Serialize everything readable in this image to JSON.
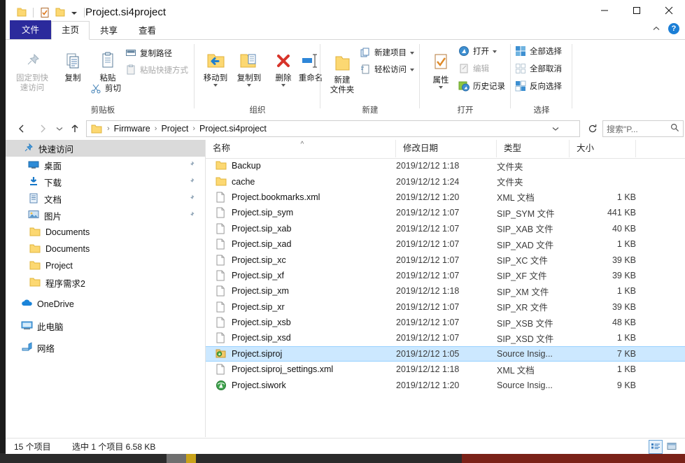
{
  "window": {
    "title": "Project.si4project",
    "quick_access": [
      "folder-icon",
      "properties-icon",
      "new-folder-icon",
      "dropdown-caret-icon"
    ],
    "controls": {
      "minimize": "minimize-icon",
      "maximize": "maximize-icon",
      "close": "close-icon"
    }
  },
  "ribbon": {
    "tabs": [
      {
        "label": "文件",
        "kind": "file"
      },
      {
        "label": "主页",
        "kind": "active"
      },
      {
        "label": "共享",
        "kind": "normal"
      },
      {
        "label": "查看",
        "kind": "normal"
      }
    ],
    "collapse_icon": "chevron-up-icon",
    "help_label": "?",
    "groups": [
      {
        "name": "剪贴板",
        "big_buttons": [
          {
            "label": "固定到快\n速访问",
            "icon": "pin-icon",
            "disabled": true
          },
          {
            "label": "复制",
            "icon": "copy-icon",
            "disabled": false
          },
          {
            "label": "粘贴",
            "icon": "paste-icon",
            "disabled": false
          }
        ],
        "small_buttons": [
          {
            "label": "复制路径",
            "icon": "copy-path-icon",
            "disabled": false
          },
          {
            "label": "粘贴快捷方式",
            "icon": "paste-shortcut-icon",
            "disabled": true
          },
          {
            "label": "剪切",
            "icon": "scissors-icon",
            "disabled": false
          }
        ]
      },
      {
        "name": "组织",
        "big_buttons": [
          {
            "label": "移动到",
            "icon": "move-to-icon",
            "caret": true
          },
          {
            "label": "复制到",
            "icon": "copy-to-icon",
            "caret": true
          },
          {
            "label": "删除",
            "icon": "delete-icon",
            "caret": true
          },
          {
            "label": "重命名",
            "icon": "rename-icon",
            "caret": false
          }
        ]
      },
      {
        "name": "新建",
        "big_buttons": [
          {
            "label": "新建\n文件夹",
            "icon": "new-folder-icon"
          }
        ],
        "small_buttons": [
          {
            "label": "新建项目",
            "icon": "new-item-icon",
            "caret": true
          },
          {
            "label": "轻松访问",
            "icon": "easy-access-icon",
            "caret": true
          }
        ]
      },
      {
        "name": "打开",
        "big_buttons": [
          {
            "label": "属性",
            "icon": "properties-icon",
            "caret": true
          }
        ],
        "small_buttons": [
          {
            "label": "打开",
            "icon": "open-icon",
            "caret": true
          },
          {
            "label": "编辑",
            "icon": "edit-icon",
            "disabled": true
          },
          {
            "label": "历史记录",
            "icon": "history-icon"
          }
        ]
      },
      {
        "name": "选择",
        "small_buttons": [
          {
            "label": "全部选择",
            "icon": "select-all-icon"
          },
          {
            "label": "全部取消",
            "icon": "select-none-icon"
          },
          {
            "label": "反向选择",
            "icon": "invert-selection-icon"
          }
        ]
      }
    ]
  },
  "address": {
    "back_icon": "arrow-left-icon",
    "forward_icon": "arrow-right-icon",
    "recent_icon": "chevron-down-icon",
    "up_icon": "arrow-up-icon",
    "crumbs": [
      "Firmware",
      "Project",
      "Project.si4project"
    ],
    "dropdown_icon": "chevron-down-icon",
    "refresh_icon": "refresh-icon"
  },
  "search": {
    "placeholder": "搜索\"P...",
    "icon": "search-icon"
  },
  "sidebar": {
    "items": [
      {
        "label": "快速访问",
        "icon": "pin-star-icon",
        "selected": true,
        "indent": 0,
        "pinned": false
      },
      {
        "label": "桌面",
        "icon": "desktop-icon",
        "indent": 1,
        "pinned": true
      },
      {
        "label": "下载",
        "icon": "download-icon",
        "indent": 1,
        "pinned": true
      },
      {
        "label": "文档",
        "icon": "documents-icon",
        "indent": 1,
        "pinned": true
      },
      {
        "label": "图片",
        "icon": "pictures-icon",
        "indent": 1,
        "pinned": true
      },
      {
        "label": "Documents",
        "icon": "folder-icon",
        "indent": 1,
        "pinned": false
      },
      {
        "label": "Documents",
        "icon": "folder-icon",
        "indent": 1,
        "pinned": false
      },
      {
        "label": "Project",
        "icon": "folder-icon",
        "indent": 1,
        "pinned": false
      },
      {
        "label": "程序需求2",
        "icon": "folder-icon",
        "indent": 1,
        "pinned": false
      },
      {
        "label": "OneDrive",
        "icon": "onedrive-cloud-icon",
        "indent": 0,
        "pinned": false,
        "gap_before": true
      },
      {
        "label": "此电脑",
        "icon": "this-pc-icon",
        "indent": 0,
        "pinned": false,
        "gap_before": true
      },
      {
        "label": "网络",
        "icon": "network-icon",
        "indent": 0,
        "pinned": false,
        "gap_before": true
      }
    ]
  },
  "file_list": {
    "columns": [
      {
        "label": "名称",
        "sorted": true,
        "sort_mark": "^"
      },
      {
        "label": "修改日期",
        "sorted": false
      },
      {
        "label": "类型",
        "sorted": false
      },
      {
        "label": "大小",
        "sorted": false
      }
    ],
    "rows": [
      {
        "name": "Backup",
        "date": "2019/12/12 1:18",
        "type": "文件夹",
        "size": "",
        "icon": "folder-icon",
        "selected": false
      },
      {
        "name": "cache",
        "date": "2019/12/12 1:24",
        "type": "文件夹",
        "size": "",
        "icon": "folder-icon",
        "selected": false
      },
      {
        "name": "Project.bookmarks.xml",
        "date": "2019/12/12 1:20",
        "type": "XML 文档",
        "size": "1 KB",
        "icon": "file-icon",
        "selected": false
      },
      {
        "name": "Project.sip_sym",
        "date": "2019/12/12 1:07",
        "type": "SIP_SYM 文件",
        "size": "441 KB",
        "icon": "file-icon",
        "selected": false
      },
      {
        "name": "Project.sip_xab",
        "date": "2019/12/12 1:07",
        "type": "SIP_XAB 文件",
        "size": "40 KB",
        "icon": "file-icon",
        "selected": false
      },
      {
        "name": "Project.sip_xad",
        "date": "2019/12/12 1:07",
        "type": "SIP_XAD 文件",
        "size": "1 KB",
        "icon": "file-icon",
        "selected": false
      },
      {
        "name": "Project.sip_xc",
        "date": "2019/12/12 1:07",
        "type": "SIP_XC 文件",
        "size": "39 KB",
        "icon": "file-icon",
        "selected": false
      },
      {
        "name": "Project.sip_xf",
        "date": "2019/12/12 1:07",
        "type": "SIP_XF 文件",
        "size": "39 KB",
        "icon": "file-icon",
        "selected": false
      },
      {
        "name": "Project.sip_xm",
        "date": "2019/12/12 1:18",
        "type": "SIP_XM 文件",
        "size": "1 KB",
        "icon": "file-icon",
        "selected": false
      },
      {
        "name": "Project.sip_xr",
        "date": "2019/12/12 1:07",
        "type": "SIP_XR 文件",
        "size": "39 KB",
        "icon": "file-icon",
        "selected": false
      },
      {
        "name": "Project.sip_xsb",
        "date": "2019/12/12 1:07",
        "type": "SIP_XSB 文件",
        "size": "48 KB",
        "icon": "file-icon",
        "selected": false
      },
      {
        "name": "Project.sip_xsd",
        "date": "2019/12/12 1:07",
        "type": "SIP_XSD 文件",
        "size": "1 KB",
        "icon": "file-icon",
        "selected": false
      },
      {
        "name": "Project.siproj",
        "date": "2019/12/12 1:05",
        "type": "Source Insig...",
        "size": "7 KB",
        "icon": "siproj-icon",
        "selected": true
      },
      {
        "name": "Project.siproj_settings.xml",
        "date": "2019/12/12 1:18",
        "type": "XML 文档",
        "size": "1 KB",
        "icon": "file-icon",
        "selected": false
      },
      {
        "name": "Project.siwork",
        "date": "2019/12/12 1:20",
        "type": "Source Insig...",
        "size": "9 KB",
        "icon": "siwork-icon",
        "selected": false
      }
    ]
  },
  "status_bar": {
    "item_count": "15 个项目",
    "selection": "选中 1 个项目  6.58 KB",
    "views": [
      {
        "name": "details-view-button",
        "active": true
      },
      {
        "name": "large-icons-view-button",
        "active": false
      }
    ]
  },
  "colors": {
    "file_tab": "#2b2a9c",
    "selection_fill": "#cce8ff",
    "selection_border": "#99d1ff",
    "nav_selected": "#dadada",
    "folder_yellow": "#fcd872",
    "accent_blue": "#1c7fd6"
  }
}
